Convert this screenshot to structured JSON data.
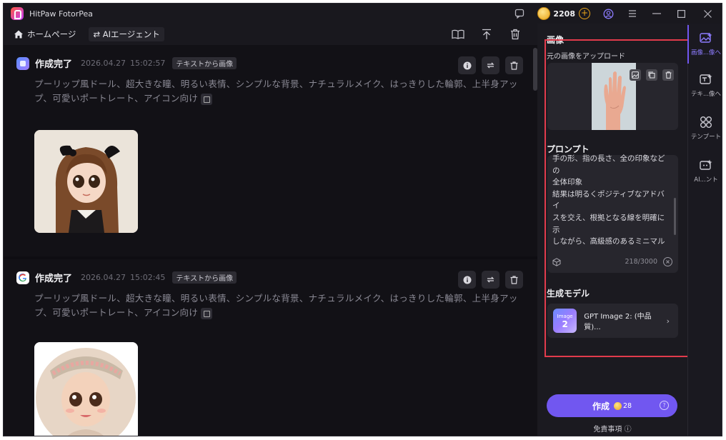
{
  "app": {
    "title": "HitPaw FotorPea",
    "credits": "2208"
  },
  "toolbar": {
    "home_label": "ホームページ",
    "agent_label": "⇄ AIエージェント"
  },
  "feed": {
    "cards": [
      {
        "status": "作成完了",
        "date": "2026.04.27",
        "time": "15:02:57",
        "tag": "テキストから画像",
        "prompt": "プーリップ風ドール、超大きな瞳、明るい表情、シンプルな背景、ナチュラルメイク、はっきりした輪郭、上半身アップ、可愛いポートレート、アイコン向け",
        "model_icon": "generic-model-icon"
      },
      {
        "status": "作成完了",
        "date": "2026.04.27",
        "time": "15:02:45",
        "tag": "テキストから画像",
        "prompt": "プーリップ風ドール、超大きな瞳、明るい表情、シンプルな背景、ナチュラルメイク、はっきりした輪郭、上半身アップ、可愛いポートレート、アイコン向け",
        "model_icon": "google-g-icon"
      }
    ]
  },
  "panel": {
    "image_section_title": "画像",
    "upload_label": "元の画像をアップロード",
    "prompt_section_title": "プロンプト",
    "prompt_text": "手の形、指の長さ、全の印象などの\n全体印象\n結果は明るくポジティブなアドバイ\nスを交え、根拠となる線を明確に示\nしながら、高級感のあるミニマルデ\nザインで出力してください。黒白の\n掌線輪郭図も必ず作成してくださ\nい。",
    "char_count": "218/3000",
    "model_section_title": "生成モデル",
    "model_name": "GPT Image 2: (中品質)...",
    "model_thumb_line1": "Image",
    "model_thumb_line2": "2",
    "create_label": "作成",
    "create_cost": "28",
    "disclaimer": "免責事項 ⓘ"
  },
  "rail": {
    "items": [
      {
        "label": "画像...像へ",
        "icon": "image-to-image-icon"
      },
      {
        "label": "テキ...像へ",
        "icon": "text-to-image-icon"
      },
      {
        "label": "テンプート",
        "icon": "template-icon"
      },
      {
        "label": "AI...ント",
        "icon": "ai-agent-icon"
      }
    ]
  },
  "colors": {
    "accent": "#7157f0",
    "highlight_box": "#e23b4c",
    "coin": "#e9a419"
  }
}
